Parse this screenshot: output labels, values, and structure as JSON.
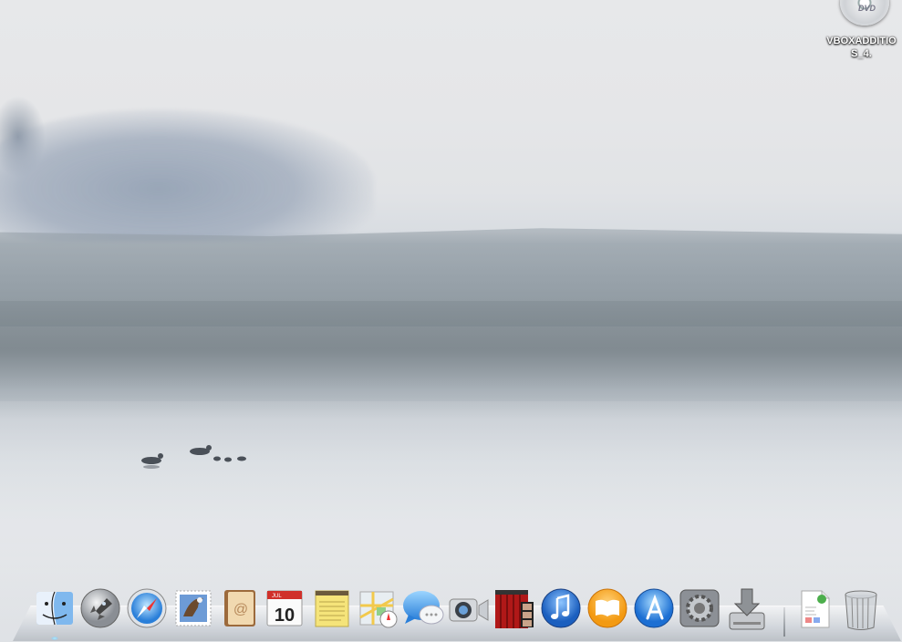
{
  "desktop": {
    "wallpaper": "misty lake at dawn",
    "icons": [
      {
        "name": "dvd-icon",
        "disc_text": "DVD",
        "label_line1": "VBOXADDITIO",
        "label_line2": "S_4."
      }
    ]
  },
  "dock": {
    "items": [
      {
        "id": "finder",
        "icon": "finder-icon"
      },
      {
        "id": "launchpad",
        "icon": "rocket-icon"
      },
      {
        "id": "safari",
        "icon": "compass-icon"
      },
      {
        "id": "mail",
        "icon": "stamp-eagle-icon"
      },
      {
        "id": "contacts",
        "icon": "address-book-icon"
      },
      {
        "id": "calendar",
        "icon": "calendar-icon",
        "month": "JUL",
        "day": "10"
      },
      {
        "id": "notes",
        "icon": "notepad-icon"
      },
      {
        "id": "maps",
        "icon": "map-icon"
      },
      {
        "id": "messages",
        "icon": "speech-bubble-icon"
      },
      {
        "id": "facetime",
        "icon": "video-camera-icon"
      },
      {
        "id": "photobooth",
        "icon": "photo-booth-icon"
      },
      {
        "id": "itunes",
        "icon": "music-note-icon"
      },
      {
        "id": "ibooks",
        "icon": "open-book-icon"
      },
      {
        "id": "appstore",
        "icon": "app-store-icon"
      },
      {
        "id": "system-preferences",
        "icon": "gear-icon"
      },
      {
        "id": "installer",
        "icon": "download-drive-icon"
      },
      {
        "id": "documents",
        "icon": "document-stack-icon"
      },
      {
        "id": "trash",
        "icon": "trash-icon"
      }
    ]
  },
  "colors": {
    "accent_blue": "#2a7fd9",
    "itunes_blue": "#1b5fbf",
    "ibooks_orange": "#f39a12",
    "calendar_red": "#d0302a",
    "notes_yellow": "#f5e47a"
  }
}
